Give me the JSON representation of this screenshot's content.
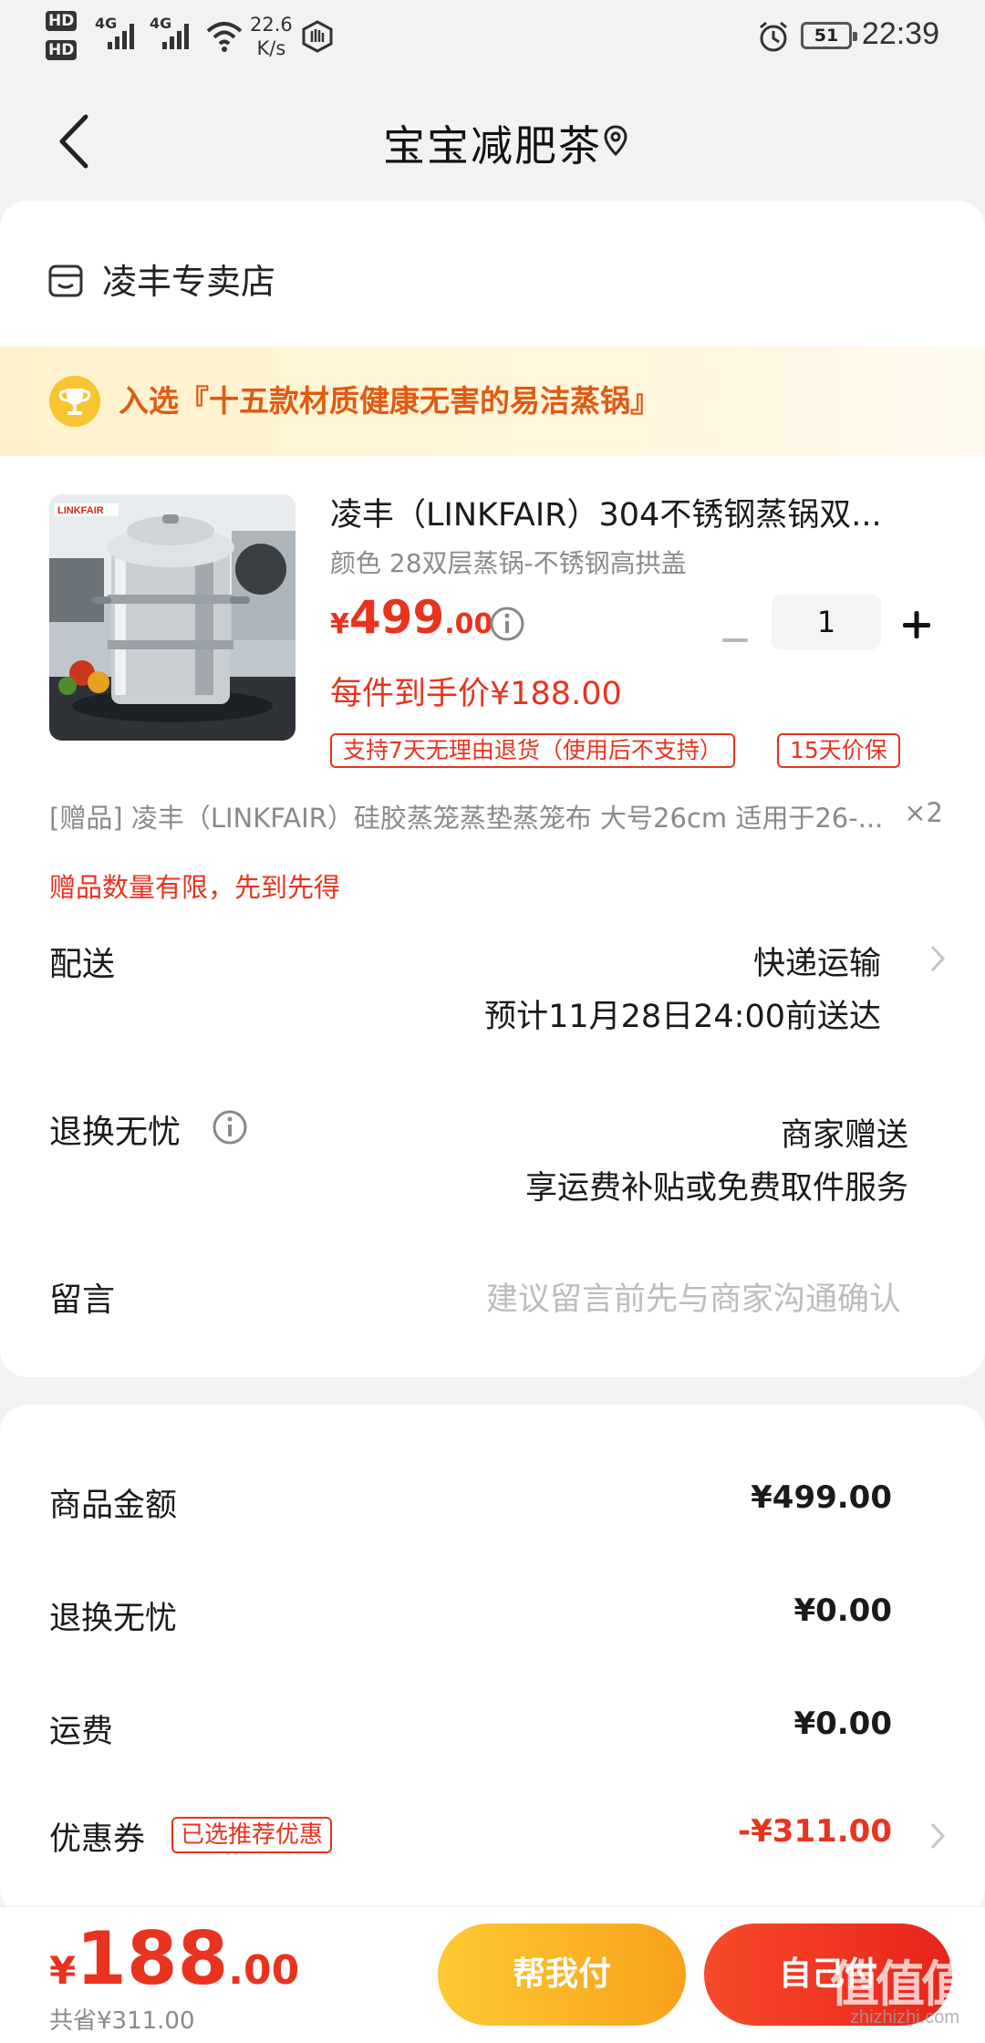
{
  "status_bar": {
    "hd1": "HD",
    "hd2": "HD",
    "net1": "4G",
    "net2": "4G",
    "speed_value": "22.6",
    "speed_unit": "K/s",
    "battery": "51",
    "time": "22:39"
  },
  "header": {
    "title": "宝宝减肥茶"
  },
  "store": {
    "name": "凌丰专卖店"
  },
  "banner": {
    "text": "入选『十五款材质健康无害的易洁蒸锅』"
  },
  "product": {
    "brand_on_image": "LINKFAIR",
    "title": "凌丰（LINKFAIR）304不锈钢蒸锅双...",
    "spec": "颜色 28双层蒸锅-不锈钢高拱盖",
    "price_currency": "¥",
    "price_int": "499",
    "price_dec": ".00",
    "quantity": "1",
    "each_price": "每件到手价¥188.00",
    "tags": [
      "支持7天无理由退货（使用后不支持）",
      "15天价保"
    ]
  },
  "gift": {
    "text": "[赠品]  凌丰（LINKFAIR）硅胶蒸笼蒸垫蒸笼布 大号26cm 适用于26-...",
    "count": "×2",
    "note": "赠品数量有限，先到先得"
  },
  "delivery": {
    "label": "配送",
    "method": "快递运输",
    "eta": "预计11月28日24:00前送达"
  },
  "return_service": {
    "label": "退换无忧",
    "provider": "商家赠送",
    "desc": "享运费补贴或免费取件服务"
  },
  "message": {
    "label": "留言",
    "placeholder": "建议留言前先与商家沟通确认"
  },
  "summary": {
    "goods_label": "商品金额",
    "goods_value": "¥499.00",
    "return_label": "退换无忧",
    "return_value": "¥0.00",
    "shipping_label": "运费",
    "shipping_value": "¥0.00",
    "coupon_label": "优惠券",
    "coupon_tag": "已选推荐优惠",
    "coupon_value": "-¥311.00"
  },
  "footer": {
    "total_currency": "¥",
    "total_int": "188",
    "total_dec": ".00",
    "saved": "共省¥311.00",
    "help_pay": "帮我付",
    "self_pay": "自己付",
    "watermark": "值值值",
    "watermark_url": "zhizhizhi.com"
  },
  "colors": {
    "accent_red": "#e8331f",
    "banner_orange": "#e05a12",
    "help_button": "#f7a21b"
  }
}
